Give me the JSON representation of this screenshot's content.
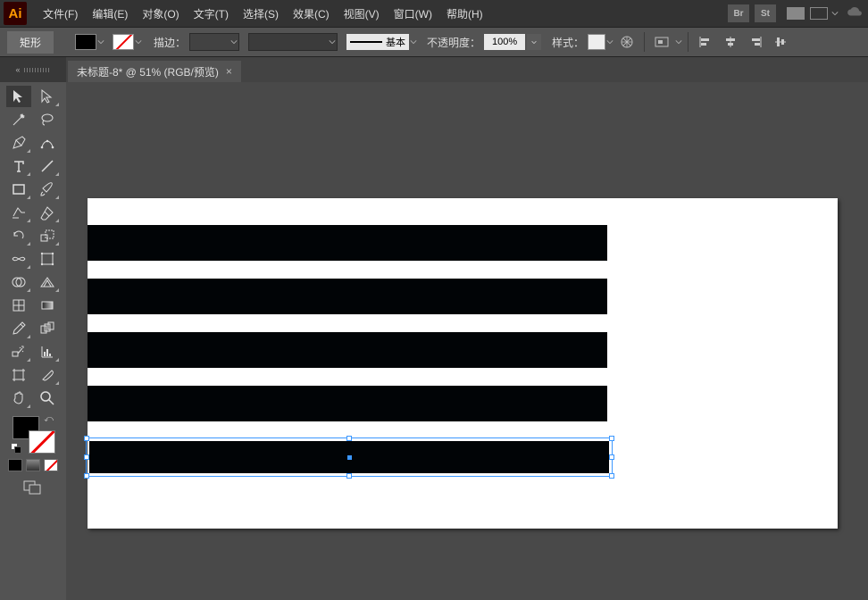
{
  "app": {
    "logo": "Ai"
  },
  "menu": {
    "items": [
      "文件(F)",
      "编辑(E)",
      "对象(O)",
      "文字(T)",
      "选择(S)",
      "效果(C)",
      "视图(V)",
      "窗口(W)",
      "帮助(H)"
    ],
    "br_label": "Br",
    "st_label": "St"
  },
  "options": {
    "mode_label": "矩形",
    "stroke_label": "描边：",
    "stroke_weight": "",
    "profile_label": "基本",
    "opacity_label": "不透明度：",
    "opacity_value": "100%",
    "style_label": "样式："
  },
  "doc_tab": {
    "title": "未标题-8* @ 51% (RGB/预览)",
    "close": "×"
  },
  "colors": {
    "fill": "#000000",
    "stroke": "none",
    "accent": "#3b97ff"
  }
}
